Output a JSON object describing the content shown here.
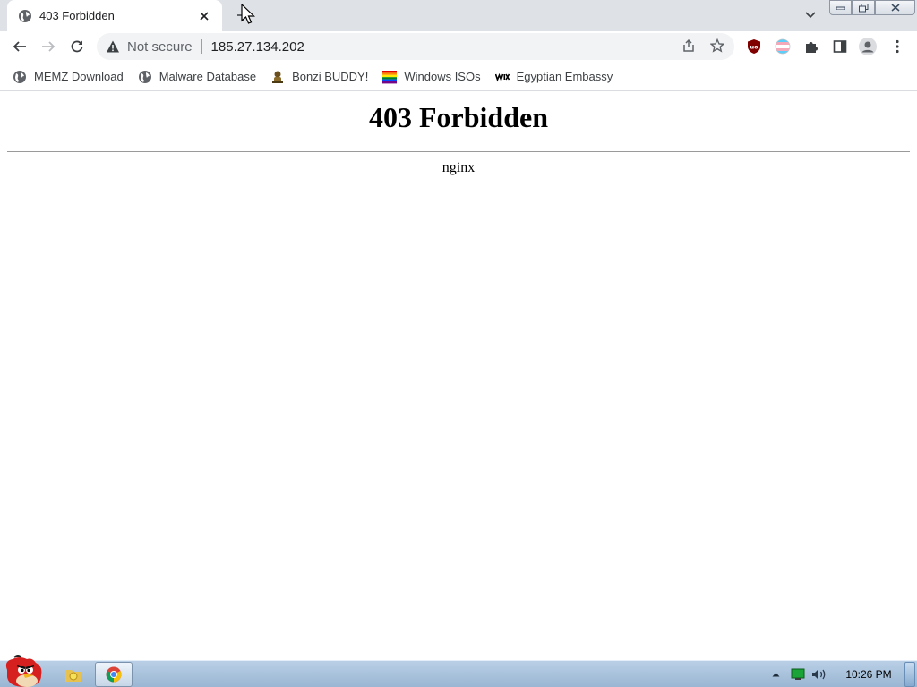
{
  "tabs": [
    {
      "title": "403 Forbidden",
      "favicon": "globe-icon"
    }
  ],
  "toolbar": {
    "security_label": "Not secure",
    "url": "185.27.134.202"
  },
  "bookmarks": [
    {
      "label": "MEMZ Download",
      "icon": "globe-icon"
    },
    {
      "label": "Malware Database",
      "icon": "globe-icon"
    },
    {
      "label": "Bonzi BUDDY!",
      "icon": "bonzi-icon"
    },
    {
      "label": "Windows ISOs",
      "icon": "rainbow-flag-icon"
    },
    {
      "label": "Egyptian Embassy",
      "icon": "wix-icon"
    }
  ],
  "page": {
    "heading": "403 Forbidden",
    "server": "nginx"
  },
  "taskbar": {
    "clock": "10:26 PM"
  }
}
